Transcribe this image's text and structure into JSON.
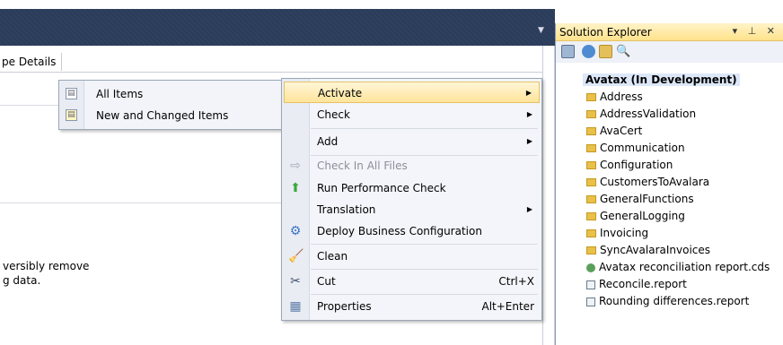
{
  "doc": {
    "tab_label": "pe Details",
    "text_line1": "versibly remove",
    "text_line2": "g data."
  },
  "solution_explorer": {
    "title": "Solution Explorer",
    "controls": "▾ ⊥ ✕",
    "toolbar_icons": [
      "properties-icon",
      "refresh-icon",
      "show-all-files-icon",
      "search-icon"
    ],
    "root": "Avatax (In Development)",
    "items": [
      {
        "label": "Address",
        "kind": "folder"
      },
      {
        "label": "AddressValidation",
        "kind": "folder"
      },
      {
        "label": "AvaCert",
        "kind": "folder"
      },
      {
        "label": "Communication",
        "kind": "folder"
      },
      {
        "label": "Configuration",
        "kind": "folder"
      },
      {
        "label": "CustomersToAvalara",
        "kind": "folder"
      },
      {
        "label": "GeneralFunctions",
        "kind": "folder"
      },
      {
        "label": "GeneralLogging",
        "kind": "folder"
      },
      {
        "label": "Invoicing",
        "kind": "folder"
      },
      {
        "label": "SyncAvalaraInvoices",
        "kind": "folder"
      },
      {
        "label": "Avatax reconciliation report.cds",
        "kind": "cds"
      },
      {
        "label": "Reconcile.report",
        "kind": "report"
      },
      {
        "label": "Rounding differences.report",
        "kind": "report"
      }
    ]
  },
  "submenu": {
    "items": [
      {
        "label": "All Items",
        "icon": "all-items-icon"
      },
      {
        "label": "New and Changed Items",
        "icon": "new-changed-items-icon"
      }
    ]
  },
  "context_menu": {
    "activate": "Activate",
    "check": "Check",
    "add": "Add",
    "check_in_all": "Check In All Files",
    "run_perf": "Run Performance Check",
    "translation": "Translation",
    "deploy": "Deploy Business Configuration",
    "clean": "Clean",
    "cut": "Cut",
    "cut_shortcut": "Ctrl+X",
    "properties": "Properties",
    "properties_shortcut": "Alt+Enter"
  },
  "colors": {
    "title_bar": "#2b3c59",
    "highlight": "#ffe49a",
    "folder": "#e8c04a"
  }
}
